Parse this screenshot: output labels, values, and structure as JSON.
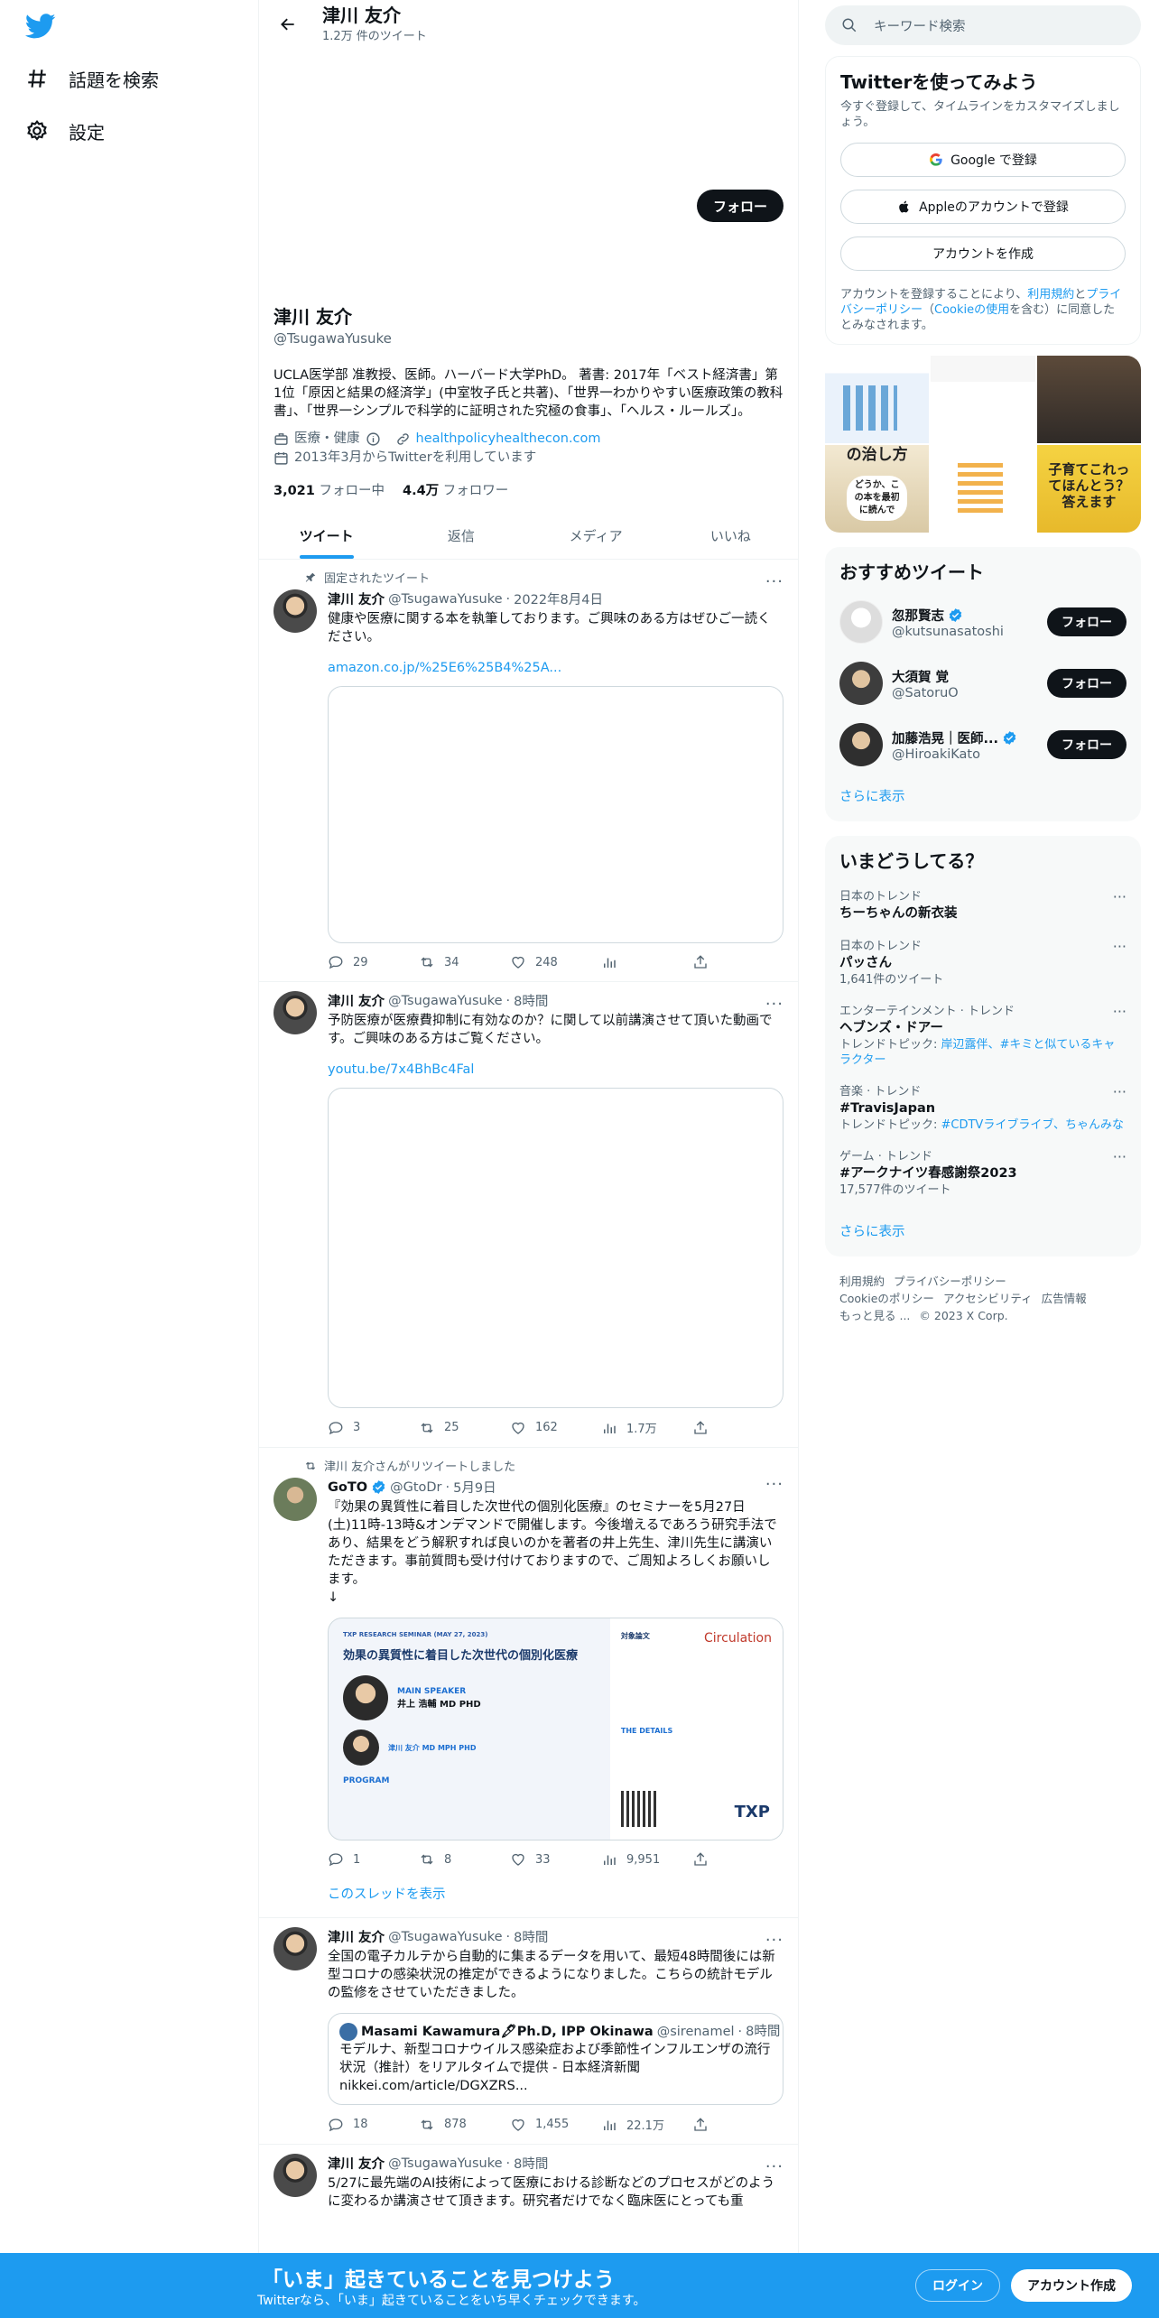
{
  "nav": {
    "explore_label": "話題を検索",
    "settings_label": "設定"
  },
  "header": {
    "name": "津川 友介",
    "tweet_count": "1.2万 件のツイート"
  },
  "profile": {
    "follow_label": "フォロー",
    "name": "津川 友介",
    "handle": "@TsugawaYusuke",
    "bio": "UCLA医学部 准教授、医師。ハーバード大学PhD。 著書: 2017年「ベスト経済書」第1位「原因と結果の経済学」(中室牧子氏と共著)、「世界一わかりやすい医療政策の教科書」、「世界一シンプルで科学的に証明された究極の食事」、「ヘルス・ルールズ」。",
    "category": "医療・健康",
    "website": "healthpolicyhealthecon.com",
    "joined": "2013年3月からTwitterを利用しています",
    "following_count": "3,021",
    "following_label": "フォロー中",
    "followers_count": "4.4万",
    "followers_label": "フォロワー"
  },
  "tabs": [
    {
      "label": "ツイート"
    },
    {
      "label": "返信"
    },
    {
      "label": "メディア"
    },
    {
      "label": "いいね"
    }
  ],
  "tweets": [
    {
      "pinned_label": "固定されたツイート",
      "name": "津川 友介",
      "handle": "@TsugawaYusuke",
      "time": "2022年8月4日",
      "text": "健康や医療に関する本を執筆しております。ご興味のある方はぜひご一読ください。",
      "link": "amazon.co.jp/%25E6%25B4%25A...",
      "replies": "29",
      "retweets": "34",
      "likes": "248"
    },
    {
      "name": "津川 友介",
      "handle": "@TsugawaYusuke",
      "time": "8時間",
      "text": "予防医療が医療費抑制に有効なのか？に関して以前講演させて頂いた動画です。ご興味のある方はご覧ください。",
      "link": "youtu.be/7x4BhBc4Fal",
      "replies": "3",
      "retweets": "25",
      "likes": "162",
      "views": "1.7万"
    },
    {
      "retweet_label": "津川 友介さんがリツイートしました",
      "name": "GoTO",
      "handle": "@GtoDr",
      "time": "5月9日",
      "text": "『効果の異質性に着目した次世代の個別化医療』のセミナーを5月27日(土)11時-13時&オンデマンドで開催します。今後増えるであろう研究手法であり、結果をどう解釈すれば良いのかを著者の井上先生、津川先生に講演いただきます。事前質問も受け付けておりますので、ご周知よろしくお願いします。\n↓",
      "replies": "1",
      "retweets": "8",
      "likes": "33",
      "views": "9,951",
      "thread_label": "このスレッドを表示",
      "image": {
        "series": "TXP RESEARCH SEMINAR (MAY 27, 2023)",
        "title": "効果の異質性に着目した次世代の個別化医療",
        "speaker_label": "MAIN SPEAKER",
        "speaker1": "井上 浩輔 MD PHD",
        "speaker2": "津川 友介 MD MPH PHD",
        "program_label": "PROGRAM",
        "ref_label": "対象論文",
        "journal": "Circulation",
        "details_label": "THE DETAILS",
        "logo": "TXP"
      }
    },
    {
      "name": "津川 友介",
      "handle": "@TsugawaYusuke",
      "time": "8時間",
      "text": "全国の電子カルテから自動的に集まるデータを用いて、最短48時間後には新型コロナの感染状況の推定ができるようになりました。こちらの統計モデルの監修をさせていただきました。",
      "quote": {
        "name": "Masami Kawamura🖋Ph.D, IPP Okinawa",
        "handle": "@sirenamel",
        "time": "8時間",
        "text": "モデルナ、新型コロナウイルス感染症および季節性インフルエンザの流行状況（推計）をリアルタイムで提供 - 日本経済新聞 nikkei.com/article/DGXZRS..."
      },
      "replies": "18",
      "retweets": "878",
      "likes": "1,455",
      "views": "22.1万"
    },
    {
      "name": "津川 友介",
      "handle": "@TsugawaYusuke",
      "time": "8時間",
      "text": "5/27に最先端のAI技術によって医療における診断などのプロセスがどのように変わるか講演させて頂きます。研究者だけでなく臨床医にとっても重"
    }
  ],
  "sidebar": {
    "search_placeholder": "キーワード検索",
    "signup": {
      "title": "Twitterを使ってみよう",
      "lead": "今すぐ登録して、タイムラインをカスタマイズしましょう。",
      "google": "Google で登録",
      "apple": "Appleのアカウントで登録",
      "create": "アカウントを作成",
      "legal_1": "アカウントを登録することにより、",
      "legal_terms": "利用規約",
      "legal_2": "と",
      "legal_privacy": "プライバシーポリシー",
      "legal_3": "（",
      "legal_cookie": "Cookieの使用",
      "legal_4": "を含む）に同意したとみなされます。"
    },
    "photos": {
      "p4_text": "の治し方",
      "p4_text2": "どうか、この本を最初に読んで",
      "p6_text": "子育てこれってほんとう？答えます"
    },
    "who_to_follow": {
      "title": "おすすめツイート",
      "users": [
        {
          "name": "忽那賢志",
          "handle": "@kutsunasatoshi",
          "verified": true
        },
        {
          "name": "大須賀 覚",
          "handle": "@SatoruO",
          "verified": false
        },
        {
          "name": "加藤浩晃｜医師...",
          "handle": "@HiroakiKato",
          "verified": true
        }
      ],
      "follow_label": "フォロー",
      "more": "さらに表示"
    },
    "trends": {
      "title": "いまどうしてる？",
      "items": [
        {
          "context": "日本のトレンド",
          "title": "ちーちゃんの新衣装"
        },
        {
          "context": "日本のトレンド",
          "title": "パッさん",
          "count": "1,641件のツイート"
        },
        {
          "context": "エンターテインメント · トレンド",
          "title": "ヘブンズ・ドアー",
          "topic_label": "トレンドトピック: ",
          "topic": "岸辺露伴、#キミと似ているキャラクター"
        },
        {
          "context": "音楽 · トレンド",
          "title": "#TravisJapan",
          "topic_label": "トレンドトピック: ",
          "topic": "#CDTVライブライブ、ちゃんみな"
        },
        {
          "context": "ゲーム · トレンド",
          "title": "#アークナイツ春感謝祭2023",
          "count": "17,577件のツイート"
        }
      ],
      "more": "さらに表示"
    },
    "footer": {
      "terms": "利用規約",
      "privacy": "プライバシーポリシー",
      "cookie": "Cookieのポリシー",
      "accessibility": "アクセシビリティ",
      "ads": "広告情報",
      "more": "もっと見る ...",
      "copyright": "© 2023 X Corp."
    }
  },
  "bottom_bar": {
    "headline": "「いま」起きていることを見つけよう",
    "sub": "Twitterなら、「いま」起きていることをいち早くチェックできます。",
    "login": "ログイン",
    "signup": "アカウント作成"
  },
  "colors": {
    "accent": "#1d9bf0",
    "text": "#0f1419",
    "muted": "#536471"
  }
}
